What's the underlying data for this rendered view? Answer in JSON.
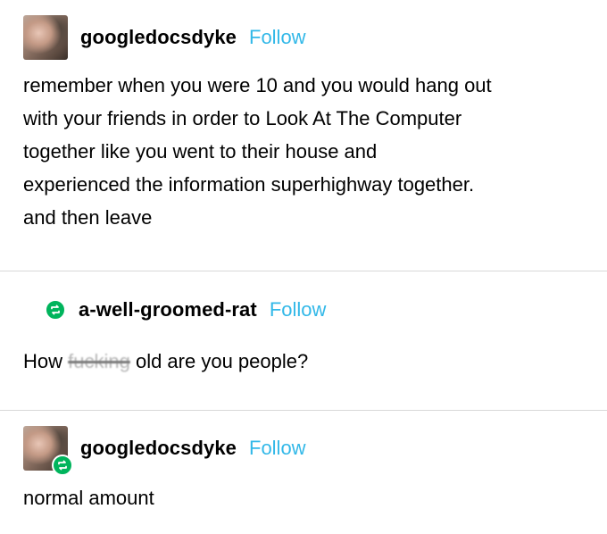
{
  "posts": [
    {
      "username": "googledocsdyke",
      "follow_label": "Follow",
      "lines": [
        "remember when you were 10 and you would hang out",
        "with your friends in order to Look At The Computer",
        "together like you went to their house and",
        "experienced the information superhighway together.",
        "and then leave"
      ]
    },
    {
      "username": "a-well-groomed-rat",
      "follow_label": "Follow",
      "text_before": "How ",
      "text_censored": "fucking",
      "text_after": " old are you people?"
    },
    {
      "username": "googledocsdyke",
      "follow_label": "Follow",
      "text": "normal amount"
    }
  ],
  "icons": {
    "avatar": "user-avatar-photo",
    "reblog": "reblog-icon"
  },
  "colors": {
    "follow": "#32b8e8",
    "reblog_badge": "#00b45c",
    "divider": "#d8d8d8"
  }
}
